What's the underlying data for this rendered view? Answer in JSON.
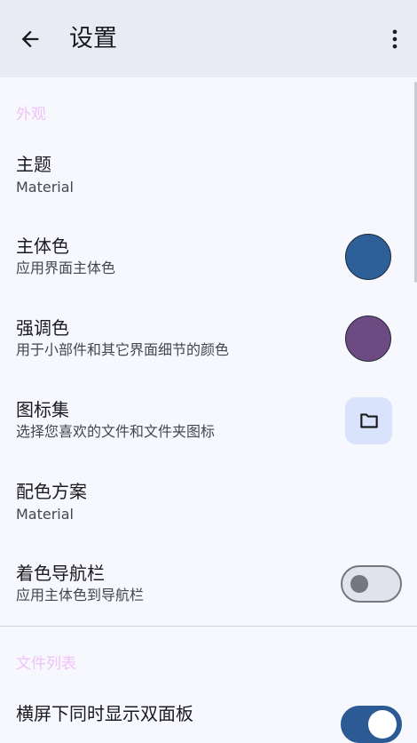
{
  "appbar": {
    "title": "设置",
    "back_icon": "arrow-back-icon",
    "more_icon": "more-vert-icon"
  },
  "sections": [
    {
      "header": "外观",
      "items": [
        {
          "title": "主题",
          "subtitle": "Material"
        },
        {
          "title": "主体色",
          "subtitle": "应用界面主体色",
          "color": "#2d5f98"
        },
        {
          "title": "强调色",
          "subtitle": "用于小部件和其它界面细节的颜色",
          "color": "#6d4a82"
        },
        {
          "title": "图标集",
          "subtitle": "选择您喜欢的文件和文件夹图标",
          "icon": "folder-icon"
        },
        {
          "title": "配色方案",
          "subtitle": "Material"
        },
        {
          "title": "着色导航栏",
          "subtitle": "应用主体色到导航栏",
          "switch_on": false
        }
      ]
    },
    {
      "header": "文件列表",
      "items": [
        {
          "title": "横屏下同时显示双面板",
          "switch_on": true
        }
      ]
    }
  ],
  "colors": {
    "appbar_bg": "#e8ebf3",
    "page_bg": "#f6f8fe",
    "section_header": "#f0c2f5",
    "primary_switch": "#2b5a95"
  }
}
